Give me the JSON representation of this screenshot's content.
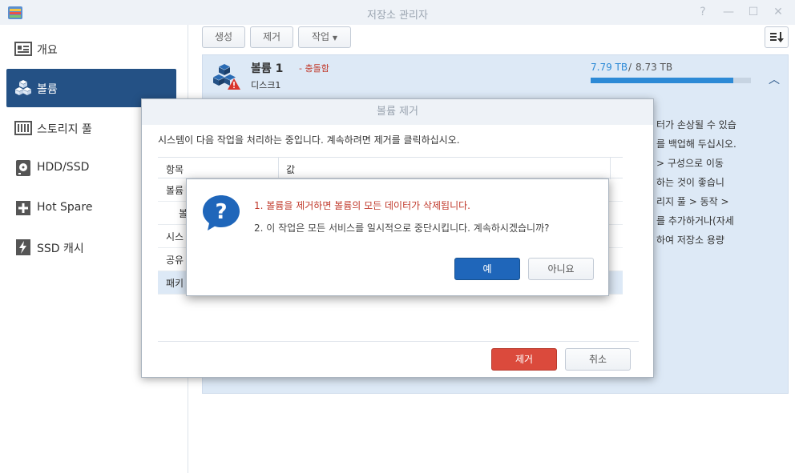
{
  "window": {
    "title": "저장소 관리자"
  },
  "sidebar": {
    "items": [
      {
        "label": "개요",
        "icon": "overview-icon"
      },
      {
        "label": "볼륨",
        "icon": "volume-icon",
        "active": true
      },
      {
        "label": "스토리지 풀",
        "icon": "storage-pool-icon"
      },
      {
        "label": "HDD/SSD",
        "icon": "disk-icon"
      },
      {
        "label": "Hot Spare",
        "icon": "hot-spare-icon"
      },
      {
        "label": "SSD 캐시",
        "icon": "ssd-cache-icon"
      }
    ]
  },
  "toolbar": {
    "create": "생성",
    "remove": "제거",
    "action": "작업"
  },
  "volume": {
    "name": "볼륨 1",
    "status_sep": "-",
    "status": "충돌함",
    "subtitle": "디스크1",
    "used": "7.79 TB",
    "sep": "/",
    "total": "8.73 TB",
    "usage_fraction": 0.892,
    "background_lines": [
      "터가 손상될 수 있습",
      "를 백업해 두십시오.",
      "> 구성으로 이동",
      "하는 것이 좋습니",
      "리지 풀 > 동작 >",
      "를 추가하거나(자세",
      "하여 저장소 용량"
    ]
  },
  "remove_dialog": {
    "title": "볼륨 제거",
    "description": "시스템이 다음 작업을 처리하는 중입니다. 계속하려면 제거를 클릭하십시오.",
    "col_item": "항목",
    "col_value": "값",
    "rows": [
      "볼륨",
      "볼",
      "시스",
      "공유",
      "패키"
    ],
    "remove_button": "제거",
    "cancel_button": "취소"
  },
  "confirm_dialog": {
    "message1": "1. 볼륨을 제거하면 볼륨의 모든 데이터가 삭제됩니다.",
    "message2": "2. 이 작업은 모든 서비스를 일시적으로 중단시킵니다. 계속하시겠습니까?",
    "yes_button": "예",
    "no_button": "아니요"
  },
  "colors": {
    "accent": "#245185",
    "danger": "#db4a3c",
    "primary": "#1f66ba",
    "usage": "#2d8ad6"
  }
}
